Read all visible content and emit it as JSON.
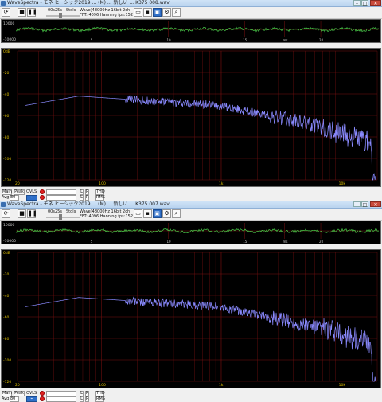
{
  "app": {
    "icons": [
      "app-icon",
      "stop-icon",
      "pause-icon",
      "open-folder-icon",
      "save-icon",
      "photo-icon",
      "settings-icon",
      "search-icon"
    ],
    "colors": {
      "waveform": "#4cd34c",
      "spectrum": "#8a8aff",
      "grid_red": "#7a1010",
      "panel_bg": "#000000",
      "axis_text": "#e0c000"
    }
  },
  "windows": [
    {
      "title": "WaveSpectra - モネ ヒーシック2019 ... (M) ... 新しい ... K375 008.wav",
      "buttons": {
        "min": "–",
        "max": "□",
        "close": "✕"
      },
      "toolbar": {
        "time": "00s25s",
        "rate": "Stdls",
        "wave_info": "Wave]48000Hz 16bit 2ch",
        "fft_info": "FFT: 4096 Hanning  fps:152"
      },
      "wave_axis": {
        "y_top": "10000",
        "y_bottom": "-10000",
        "x_ticks": [
          "5",
          "10",
          "15",
          "ms",
          "20"
        ]
      },
      "spec_axis": {
        "y_ticks": [
          "0dB",
          "-20",
          "-40",
          "-60",
          "-80",
          "-100",
          "-120"
        ],
        "x_ticks": [
          "20",
          "100",
          "1k",
          "10k"
        ]
      },
      "bottom": {
        "main_label": "Main",
        "peak_label": "Peak",
        "avg_label": "Avg",
        "avg_value": "80",
        "chk_label": "OVLS",
        "thd": "THD",
        "rms": "RMS"
      }
    },
    {
      "title": "WaveSpectra - モネ ヒーシック2019 ... (M) ... 新しい ... K375 007.wav",
      "buttons": {
        "min": "–",
        "max": "□",
        "close": "✕"
      },
      "toolbar": {
        "time": "00s25s",
        "rate": "Stdls",
        "wave_info": "Wave]48000Hz 16bit 2ch",
        "fft_info": "FFT: 4096 Hanning  fps:152"
      },
      "wave_axis": {
        "y_top": "10000",
        "y_bottom": "-10000",
        "x_ticks": [
          "5",
          "10",
          "15",
          "ms",
          "20"
        ]
      },
      "spec_axis": {
        "y_ticks": [
          "0dB",
          "-20",
          "-40",
          "-60",
          "-80",
          "-100",
          "-120"
        ],
        "x_ticks": [
          "20",
          "100",
          "1k",
          "10k"
        ]
      },
      "bottom": {
        "main_label": "Main",
        "peak_label": "Peak",
        "avg_label": "Avg",
        "avg_value": "80",
        "chk_label": "OVLS",
        "thd": "THD",
        "rms": "RMS"
      }
    }
  ]
}
